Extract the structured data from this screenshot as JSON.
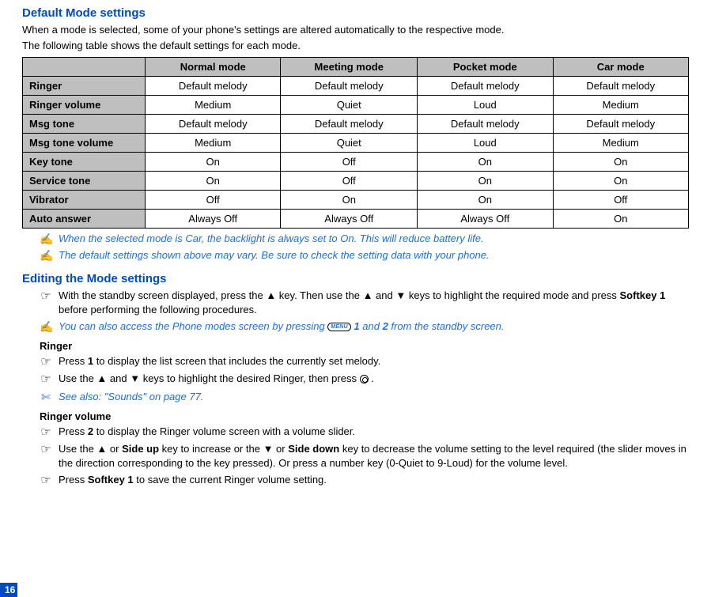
{
  "heading1": "Default Mode settings",
  "intro1": "When a mode is selected, some of your phone's settings are altered automatically to the respective mode.",
  "intro2": "The following table shows the default settings for each mode.",
  "table": {
    "col_headers": [
      "Normal mode",
      "Meeting mode",
      "Pocket mode",
      "Car mode"
    ],
    "rows": [
      {
        "label": "Ringer",
        "cells": [
          "Default melody",
          "Default melody",
          "Default melody",
          "Default melody"
        ]
      },
      {
        "label": "Ringer volume",
        "cells": [
          "Medium",
          "Quiet",
          "Loud",
          "Medium"
        ]
      },
      {
        "label": "Msg tone",
        "cells": [
          "Default melody",
          "Default melody",
          "Default melody",
          "Default melody"
        ]
      },
      {
        "label": "Msg tone volume",
        "cells": [
          "Medium",
          "Quiet",
          "Loud",
          "Medium"
        ]
      },
      {
        "label": "Key tone",
        "cells": [
          "On",
          "Off",
          "On",
          "On"
        ]
      },
      {
        "label": "Service tone",
        "cells": [
          "On",
          "Off",
          "On",
          "On"
        ]
      },
      {
        "label": "Vibrator",
        "cells": [
          "Off",
          "On",
          "On",
          "Off"
        ]
      },
      {
        "label": "Auto answer",
        "cells": [
          "Always Off",
          "Always Off",
          "Always Off",
          "On"
        ]
      }
    ]
  },
  "note1": "When the selected mode is Car, the backlight is always set to On. This will reduce battery life.",
  "note2": "The default settings shown above may vary. Be sure to check the setting data with your phone.",
  "heading2": "Editing the Mode settings",
  "edit_intro_a": "With the standby screen displayed, press the ",
  "edit_intro_b": " key. Then use the ",
  "edit_intro_c": " and ",
  "edit_intro_d": " keys to highlight the required mode and press ",
  "softkey1": "Softkey 1",
  "edit_intro_e": "  before performing the following procedures.",
  "edit_note_a": "You can also access the Phone modes screen by pressing ",
  "menu_label": "MENU",
  "edit_note_b": " ",
  "one": "1",
  "edit_note_c": " and ",
  "two": "2",
  "edit_note_d": " from the standby screen.",
  "ringer_h": "Ringer",
  "ringer_l1_a": "Press ",
  "ringer_l1_b": " to display the list screen that includes the currently set melody.",
  "ringer_l2_a": "Use the ",
  "ringer_l2_b": " and ",
  "ringer_l2_c": " keys to highlight the desired Ringer, then press ",
  "ringer_l2_d": " .",
  "see_also": "See also: \"Sounds\" on page 77.",
  "ringervol_h": "Ringer volume",
  "rv_l1_a": "Press ",
  "rv_l1_b": " to display the Ringer volume screen with a volume slider.",
  "rv_l2_a": "Use the ",
  "rv_l2_b": " or ",
  "sideup": "Side up",
  "rv_l2_c": " key to increase or the ",
  "rv_l2_d": " or ",
  "sidedown": "Side down",
  "rv_l2_e": " key to decrease the volume setting to the level required (the slider moves in the direction corresponding to the key pressed). Or press a number key (0-Quiet to 9-Loud) for the volume level.",
  "rv_l3_a": "Press ",
  "rv_l3_b": " to save the current Ringer volume setting.",
  "page_number": "16",
  "icons": {
    "hand": "☞",
    "note": "✍",
    "up": "▲",
    "down": "▼",
    "see": "✄"
  }
}
